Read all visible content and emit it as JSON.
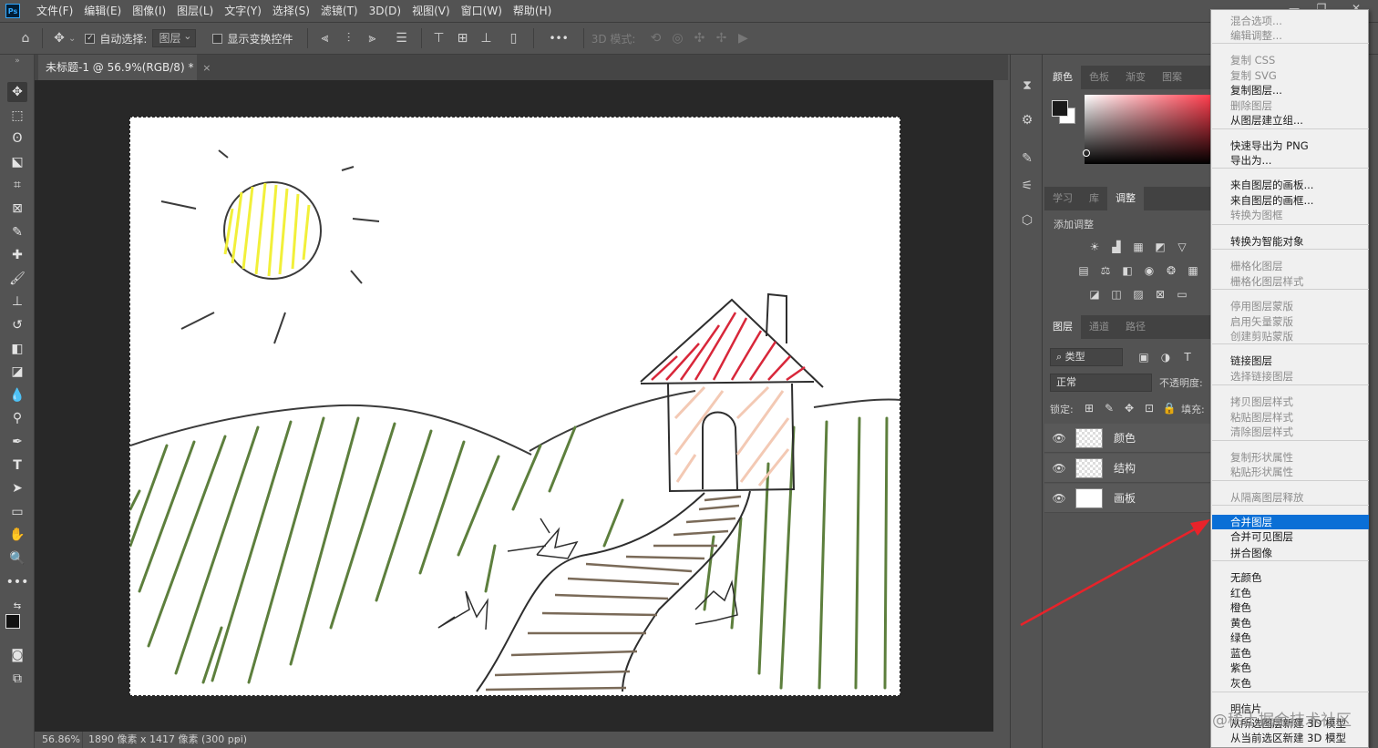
{
  "app": {
    "logo": "Ps"
  },
  "menubar": {
    "items": [
      "文件(F)",
      "编辑(E)",
      "图像(I)",
      "图层(L)",
      "文字(Y)",
      "选择(S)",
      "滤镜(T)",
      "3D(D)",
      "视图(V)",
      "窗口(W)",
      "帮助(H)"
    ]
  },
  "options": {
    "auto_select_label": "自动选择:",
    "auto_select_target": "图层",
    "show_transform_label": "显示变换控件",
    "mode_3d_label": "3D 模式:",
    "more": "•••"
  },
  "document": {
    "tab_title": "未标题-1 @ 56.9%(RGB/8) *",
    "close": "×"
  },
  "status": {
    "zoom": "56.86%",
    "doc_info": "1890 像素 x 1417 像素 (300 ppi)",
    "arrow": "›"
  },
  "color_panel": {
    "tabs": [
      "颜色",
      "色板",
      "渐变",
      "图案"
    ]
  },
  "adjust_panel": {
    "tabs": [
      "学习",
      "库",
      "调整"
    ],
    "title": "添加调整"
  },
  "layers_panel": {
    "tabs": [
      "图层",
      "通道",
      "路径"
    ],
    "filter": "类型",
    "blend_mode": "正常",
    "opacity_label": "不透明度:",
    "lock_label": "锁定:",
    "fill_label": "填充:",
    "layers": [
      {
        "name": "颜色"
      },
      {
        "name": "结构"
      },
      {
        "name": "画板"
      }
    ]
  },
  "context_menu": {
    "items": [
      {
        "label": "混合选项...",
        "enabled": false
      },
      {
        "label": "编辑调整...",
        "enabled": false
      },
      {
        "label": "复制 CSS",
        "enabled": false
      },
      {
        "label": "复制 SVG",
        "enabled": false
      },
      {
        "label": "复制图层...",
        "enabled": true
      },
      {
        "label": "删除图层",
        "enabled": false
      },
      {
        "label": "从图层建立组...",
        "enabled": true
      },
      {
        "label": "快速导出为 PNG",
        "enabled": true
      },
      {
        "label": "导出为...",
        "enabled": true
      },
      {
        "label": "来自图层的画板...",
        "enabled": true
      },
      {
        "label": "来自图层的画框...",
        "enabled": true
      },
      {
        "label": "转换为图框",
        "enabled": false
      },
      {
        "label": "转换为智能对象",
        "enabled": true
      },
      {
        "label": "栅格化图层",
        "enabled": false
      },
      {
        "label": "栅格化图层样式",
        "enabled": false
      },
      {
        "label": "停用图层蒙版",
        "enabled": false
      },
      {
        "label": "启用矢量蒙版",
        "enabled": false
      },
      {
        "label": "创建剪贴蒙版",
        "enabled": false
      },
      {
        "label": "链接图层",
        "enabled": true
      },
      {
        "label": "选择链接图层",
        "enabled": false
      },
      {
        "label": "拷贝图层样式",
        "enabled": false
      },
      {
        "label": "粘贴图层样式",
        "enabled": false
      },
      {
        "label": "清除图层样式",
        "enabled": false
      },
      {
        "label": "复制形状属性",
        "enabled": false
      },
      {
        "label": "粘贴形状属性",
        "enabled": false
      },
      {
        "label": "从隔离图层释放",
        "enabled": false
      },
      {
        "label": "合并图层",
        "enabled": true,
        "highlight": true
      },
      {
        "label": "合并可见图层",
        "enabled": true
      },
      {
        "label": "拼合图像",
        "enabled": true
      },
      {
        "label": "无颜色",
        "enabled": true
      },
      {
        "label": "红色",
        "enabled": true
      },
      {
        "label": "橙色",
        "enabled": true
      },
      {
        "label": "黄色",
        "enabled": true
      },
      {
        "label": "绿色",
        "enabled": true
      },
      {
        "label": "蓝色",
        "enabled": true
      },
      {
        "label": "紫色",
        "enabled": true
      },
      {
        "label": "灰色",
        "enabled": true
      },
      {
        "label": "明信片",
        "enabled": true
      },
      {
        "label": "从所选图层新建 3D 模型",
        "enabled": true
      },
      {
        "label": "从当前选区新建 3D 模型",
        "enabled": true
      }
    ]
  },
  "watermark": "@稀土掘金技术社区",
  "colors": {
    "accent": "#0a6fd6",
    "arrow": "#e8232a",
    "grass": "#5d7f3d",
    "sun": "#f2f03a",
    "roof": "#d8273a",
    "path": "#7a6a58",
    "wall": "#f3c9b4"
  }
}
